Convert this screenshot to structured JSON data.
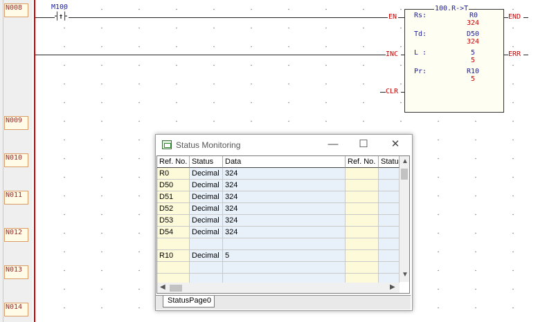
{
  "rungs": [
    {
      "label": "N008"
    },
    {
      "label": "N009"
    },
    {
      "label": "N010"
    },
    {
      "label": "N011"
    },
    {
      "label": "N012"
    },
    {
      "label": "N013"
    },
    {
      "label": "N014"
    }
  ],
  "contact": {
    "address": "M100",
    "symbol": "┤↑├"
  },
  "function_block": {
    "title": "100.R->T",
    "inputs": {
      "en": "EN",
      "inc": "INC",
      "clr": "CLR"
    },
    "outputs": {
      "end": "END",
      "err": "ERR"
    },
    "params": [
      {
        "name": "Rs:",
        "operand": "R0",
        "monitor": "324"
      },
      {
        "name": "Td:",
        "operand": "D50",
        "monitor": "324"
      },
      {
        "name": "L :",
        "operand": "5",
        "monitor": "5"
      },
      {
        "name": "Pr:",
        "operand": "R10",
        "monitor": "5"
      }
    ]
  },
  "status_window": {
    "title": "Status Monitoring",
    "buttons": {
      "minimize": "—",
      "maximize": "☐",
      "close": "✕"
    },
    "headers": {
      "ref": "Ref. No.",
      "status": "Status",
      "data": "Data",
      "ref2": "Ref. No.",
      "status2": "Status"
    },
    "rows": [
      {
        "ref": "R0",
        "status": "Decimal",
        "data": "324"
      },
      {
        "ref": "D50",
        "status": "Decimal",
        "data": "324"
      },
      {
        "ref": "D51",
        "status": "Decimal",
        "data": "324"
      },
      {
        "ref": "D52",
        "status": "Decimal",
        "data": "324"
      },
      {
        "ref": "D53",
        "status": "Decimal",
        "data": "324"
      },
      {
        "ref": "D54",
        "status": "Decimal",
        "data": "324"
      },
      {
        "ref": "",
        "status": "",
        "data": ""
      },
      {
        "ref": "R10",
        "status": "Decimal",
        "data": "5"
      },
      {
        "ref": "",
        "status": "",
        "data": ""
      },
      {
        "ref": "",
        "status": "",
        "data": ""
      }
    ],
    "tab": "StatusPage0"
  }
}
